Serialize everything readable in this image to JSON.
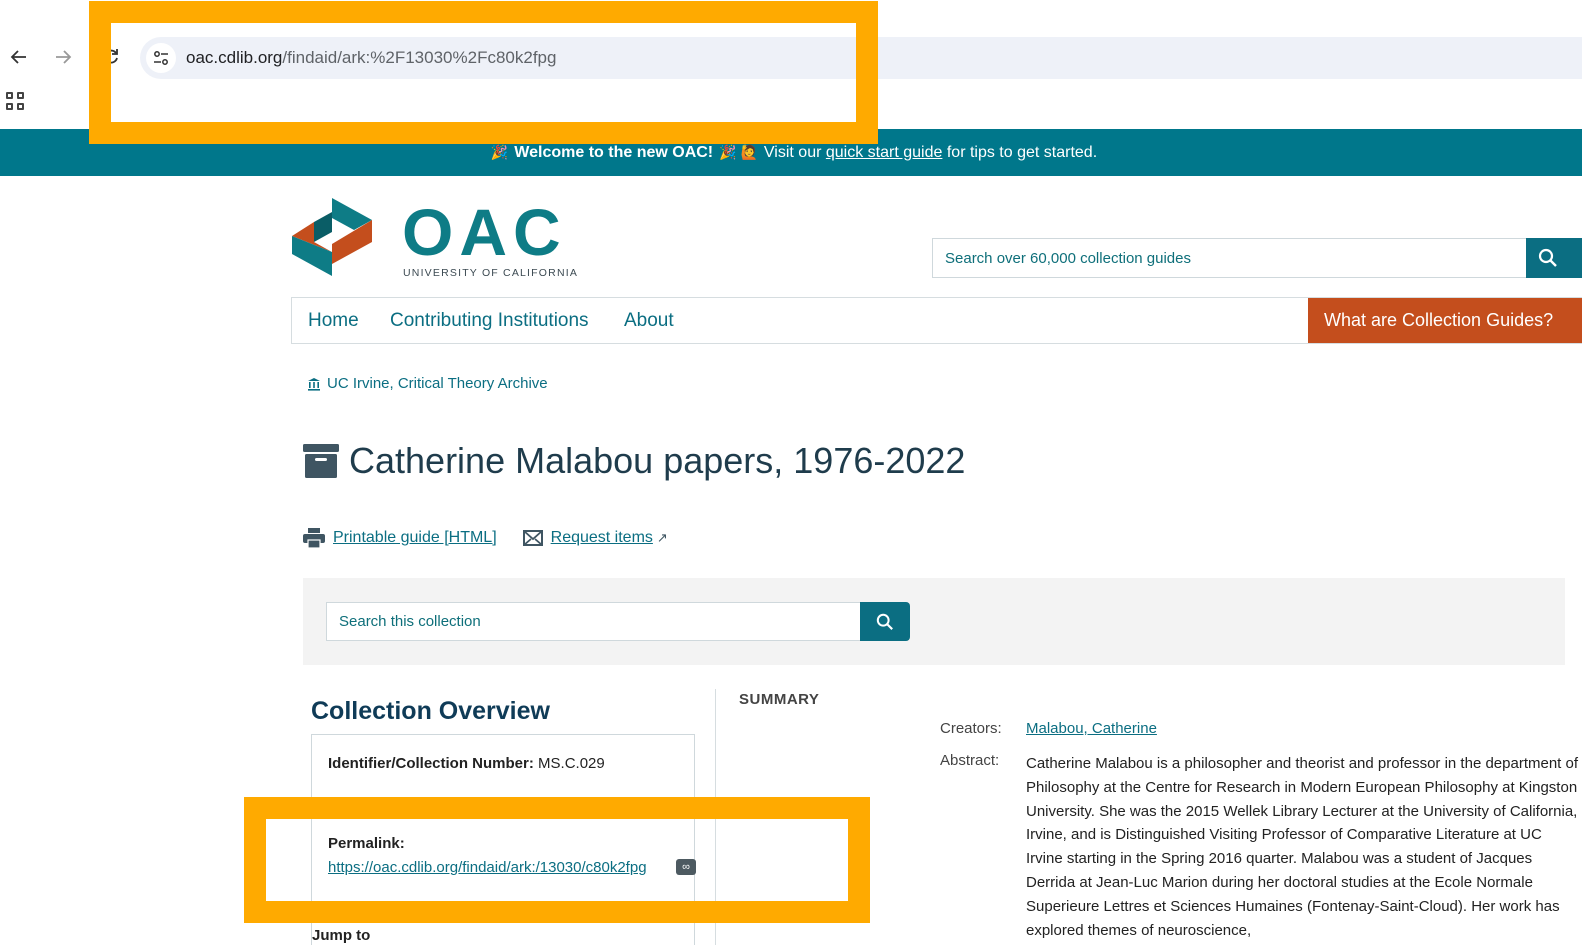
{
  "browser": {
    "url_host": "oac.cdlib.org",
    "url_path": "/findaid/ark:%2F13030%2Fc80k2fpg"
  },
  "banner": {
    "emoji_left": "🎉",
    "welcome": "Welcome to the new OAC!",
    "emoji_right": "🎉 🙋",
    "visit_prefix": "Visit our",
    "link": "quick start guide",
    "suffix": "for tips to get started."
  },
  "header": {
    "logo_text": "OAC",
    "logo_subtitle": "UNIVERSITY OF CALIFORNIA",
    "search_placeholder": "Search over 60,000 collection guides"
  },
  "nav": {
    "items": [
      "Home",
      "Contributing Institutions",
      "About"
    ],
    "cta": "What are Collection Guides?"
  },
  "institution": "UC Irvine, Critical Theory Archive",
  "title": "Catherine Malabou papers, 1976-2022",
  "actions": {
    "printable": "Printable guide [HTML]",
    "request": "Request items",
    "request_arrow": "↗"
  },
  "collection_search": {
    "placeholder": "Search this collection"
  },
  "overview": {
    "heading": "Collection Overview",
    "identifier_label": "Identifier/Collection Number:",
    "identifier_value": "MS.C.029",
    "permalink_label": "Permalink:",
    "permalink_value": "https://oac.cdlib.org/findaid/ark:/13030/c80k2fpg",
    "jump_label": "Jump to"
  },
  "summary": {
    "heading": "SUMMARY",
    "creators_label": "Creators:",
    "creators_value": "Malabou, Catherine",
    "abstract_label": "Abstract:",
    "abstract_value": "Catherine Malabou is a philosopher and theorist and professor in the department of Philosophy at the Centre for Research in Modern European Philosophy at Kingston University. She was the 2015 Wellek Library Lecturer at the University of California, Irvine, and is Distinguished Visiting Professor of Comparative Literature at UC Irvine starting in the Spring 2016 quarter. Malabou was a student of Jacques Derrida at Jean-Luc Marion during her doctoral studies at the Ecole Normale Superieure Lettres et Sciences Humaines (Fontenay-Saint-Cloud). Her work has explored themes of neuroscience,"
  },
  "colors": {
    "teal": "#00778b",
    "accent_orange": "#c44e1d",
    "highlight": "#ffaa00"
  }
}
